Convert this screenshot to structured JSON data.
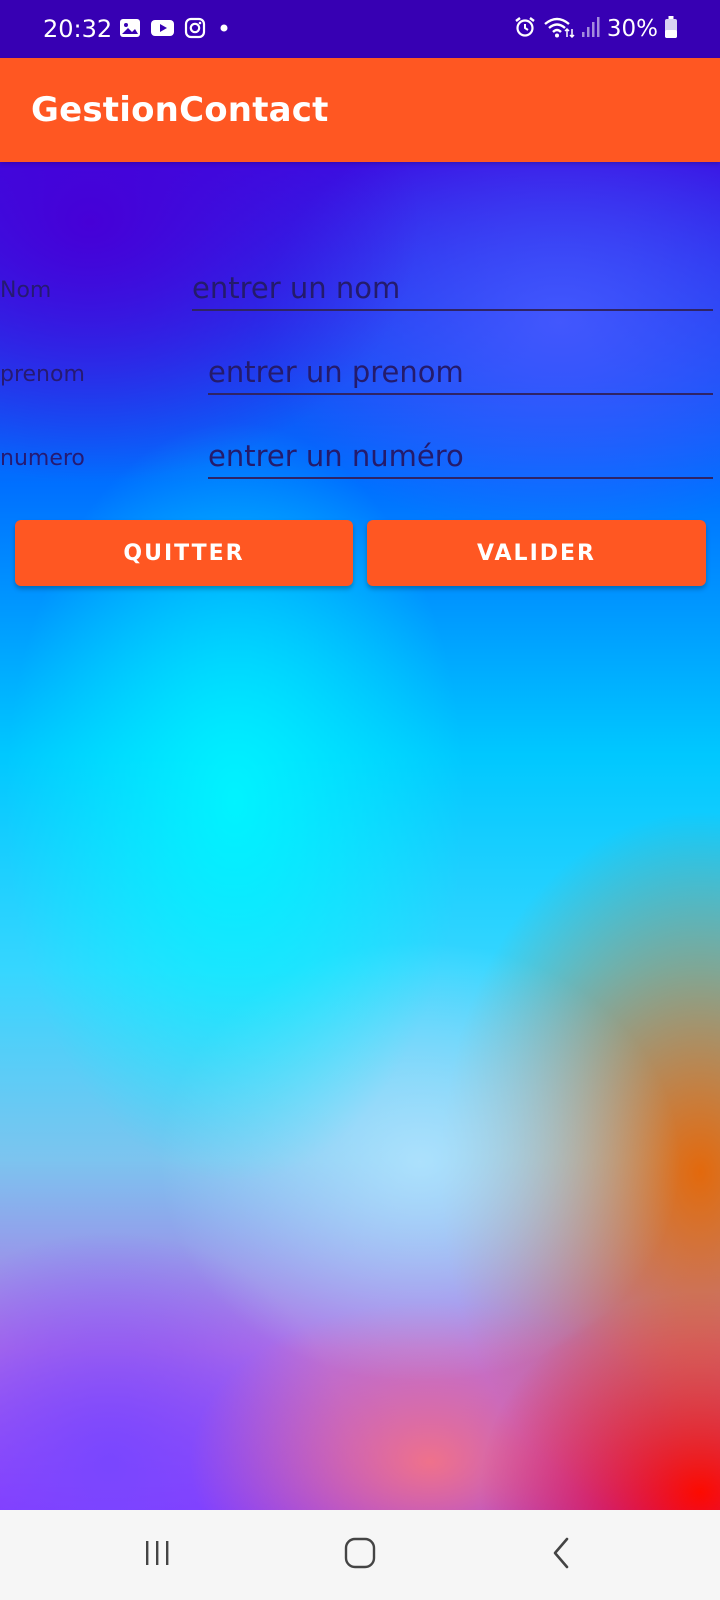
{
  "status_bar": {
    "time": "20:32",
    "left_icons": [
      "image-icon",
      "youtube-icon",
      "instagram-icon",
      "dot-icon"
    ],
    "right_icons": [
      "alarm-icon",
      "wifi-icon",
      "signal-icon",
      "battery-icon"
    ],
    "battery": "30%"
  },
  "app_bar": {
    "title": "GestionContact"
  },
  "form": {
    "nom": {
      "label": "Nom",
      "placeholder": "entrer un nom",
      "value": ""
    },
    "prenom": {
      "label": "prenom",
      "placeholder": "entrer un prenom",
      "value": ""
    },
    "numero": {
      "label": "numero",
      "placeholder": "entrer un numéro",
      "value": ""
    }
  },
  "actions": {
    "quit_label": "QUITTER",
    "validate_label": "VALIDER"
  },
  "nav_bar": {
    "icons": [
      "recents-icon",
      "home-icon",
      "back-icon"
    ]
  },
  "colors": {
    "status_bar": "#3700b3",
    "accent": "#ff5722",
    "nav_bar": "#f6f6f6"
  }
}
